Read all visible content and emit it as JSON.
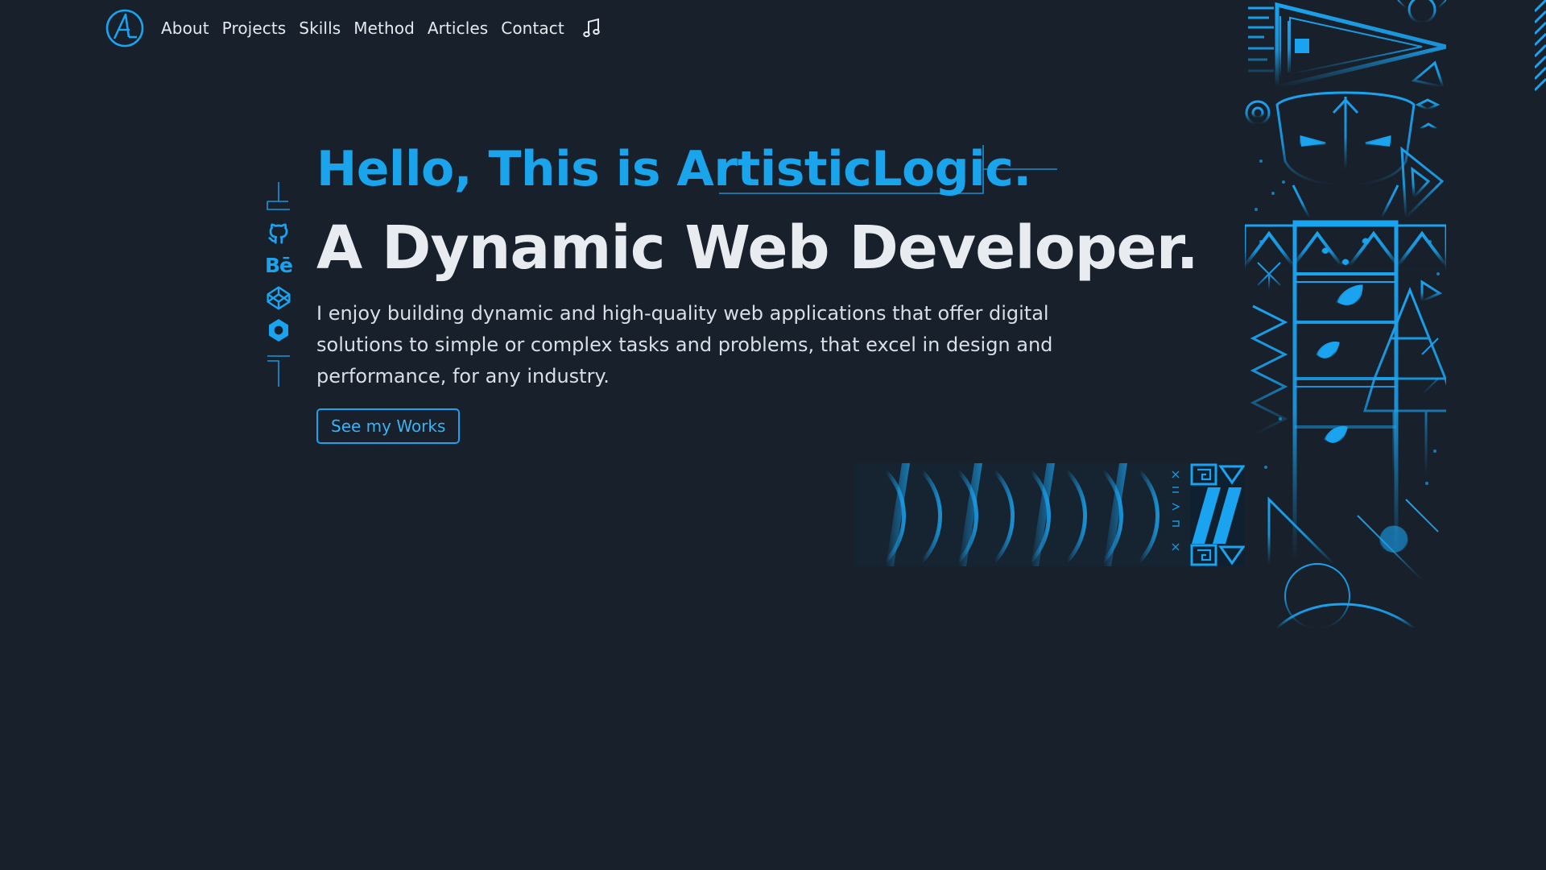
{
  "nav": {
    "logo_text": "AL",
    "items": [
      {
        "label": "About"
      },
      {
        "label": "Projects"
      },
      {
        "label": "Skills"
      },
      {
        "label": "Method"
      },
      {
        "label": "Articles"
      },
      {
        "label": "Contact"
      }
    ],
    "music_icon": "music-note-icon"
  },
  "social": {
    "icons": [
      "github-icon",
      "behance-icon",
      "codepen-icon",
      "dribbble-icon"
    ],
    "behance_label": "Bē"
  },
  "hero": {
    "greeting": "Hello, This is ArtisticLogic.",
    "headline": "A Dynamic Web Developer.",
    "intro": "I enjoy building dynamic and high-quality web applications that offer digital solutions to simple or complex tasks and problems, that excel in design and performance, for any industry.",
    "cta_label": "See my Works"
  },
  "colors": {
    "background": "#17202b",
    "accent": "#1aa3ef",
    "text": "#e8ecf1"
  }
}
